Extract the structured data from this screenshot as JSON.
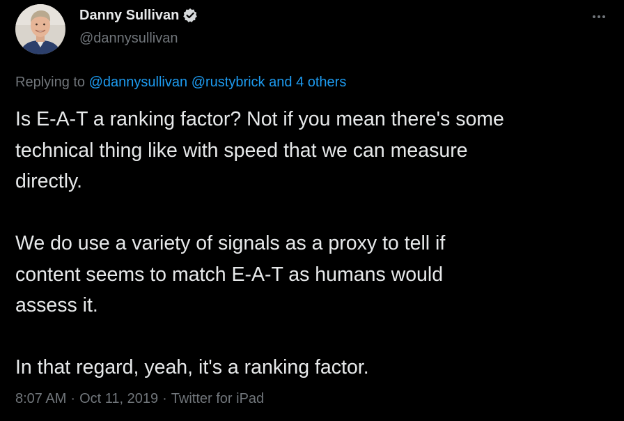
{
  "colors": {
    "background": "#000000",
    "text": "#e7e9ea",
    "secondary": "#71767b",
    "link": "#1d9bf0"
  },
  "author": {
    "name": "Danny Sullivan",
    "handle": "@dannysullivan",
    "verified": true,
    "verified_icon": "verified-badge-icon",
    "avatar_icon": "profile-photo"
  },
  "more_icon": "more-options-icon",
  "reply_context": {
    "prefix": "Replying to",
    "mention_1": "@dannysullivan",
    "mention_2": "@rustybrick",
    "connector": "and",
    "others": "4 others"
  },
  "tweet": {
    "line_1": "Is E-A-T a ranking factor? Not if you mean there's some",
    "line_2": "technical thing like with speed that we can measure",
    "line_3": "directly.",
    "line_4": "We do use a variety of signals as a proxy to tell if",
    "line_5": "content seems to match E-A-T as humans would",
    "line_6": "assess it.",
    "line_7": "In that regard, yeah, it's a ranking factor."
  },
  "meta": {
    "time": "8:07 AM",
    "separator": "·",
    "date": "Oct 11, 2019",
    "source": "Twitter for iPad"
  }
}
